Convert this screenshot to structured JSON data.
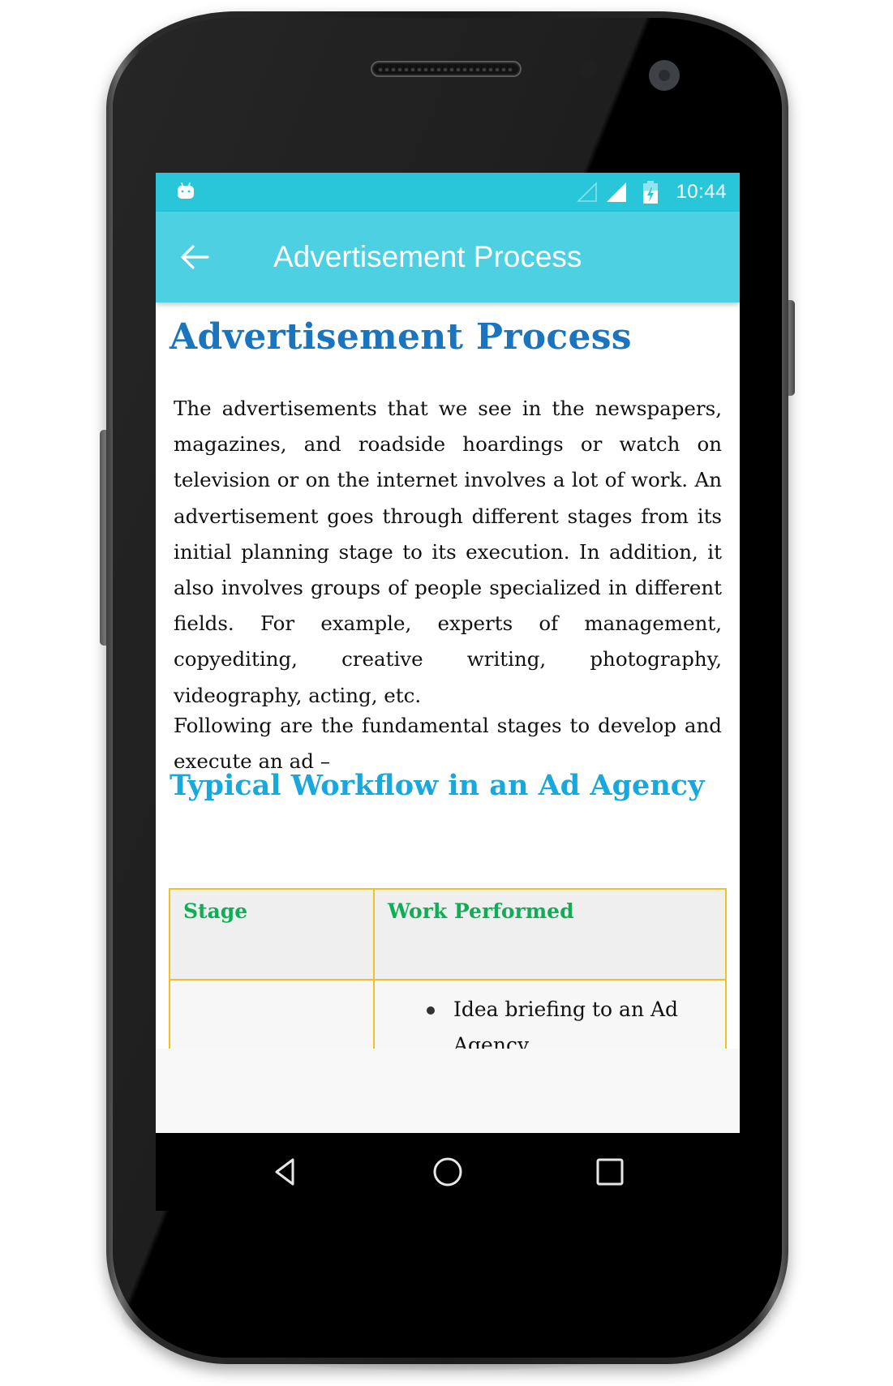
{
  "status_bar": {
    "notification_icon": "android-debug-icon",
    "signal_icons": [
      "signal-empty-icon",
      "signal-full-icon"
    ],
    "battery_icon": "battery-charging-icon",
    "time": "10:44"
  },
  "toolbar": {
    "back_icon": "arrow-left-icon",
    "title": "Advertisement Process"
  },
  "article": {
    "title": "Advertisement Process",
    "paragraphs": [
      "The advertisements that we see in the newspapers, magazines, and roadside hoardings or watch on television or on the internet involves a lot of work. An advertisement goes through different stages from its initial planning stage to its execution. In addition, it also involves groups of people specialized in different fields. For example, experts of management, copyediting, creative writing, photography, videography, acting, etc.",
      "Following are the fundamental stages to develop and execute an ad –"
    ],
    "section_title": "Typical Workflow in an Ad Agency",
    "table": {
      "headers": [
        "Stage",
        "Work Performed"
      ],
      "rows": [
        {
          "stage": "",
          "work": [
            "Idea briefing to an Ad Agency"
          ]
        }
      ]
    }
  },
  "nav_bar": {
    "buttons": [
      "back",
      "home",
      "recents"
    ]
  },
  "colors": {
    "status_bar": "#29c6da",
    "toolbar": "#4dd0e1",
    "title_blue": "#1a74be",
    "section_blue": "#18a8dc",
    "table_header_green": "#0fae55",
    "table_border": "#f0c024"
  }
}
